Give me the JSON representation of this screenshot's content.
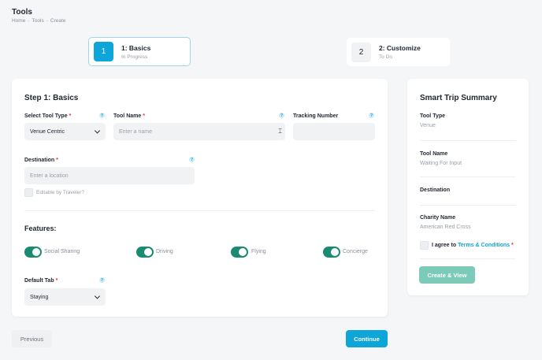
{
  "header": {
    "title": "Tools",
    "breadcrumb": [
      "Home",
      "Tools",
      "Create"
    ],
    "breadcrumb_separator": "-"
  },
  "stepper": [
    {
      "number": "1",
      "title": "1: Basics",
      "status": "In Progress"
    },
    {
      "number": "2",
      "title": "2: Customize",
      "status": "To Do"
    }
  ],
  "form": {
    "heading": "Step 1: Basics",
    "tool_type": {
      "label": "Select Tool Type",
      "required": "*",
      "value": "Venue Centric"
    },
    "tool_name": {
      "label": "Tool Name",
      "required": "*",
      "placeholder": "Enter a name"
    },
    "tracking_number": {
      "label": "Tracking Number",
      "value": ""
    },
    "destination": {
      "label": "Destination",
      "required": "*",
      "placeholder": "Enter a location"
    },
    "editable_by_traveler": {
      "label": "Editable by Traveler?"
    },
    "features_heading": "Features:",
    "features": [
      {
        "label": "Social Sharing",
        "on": true
      },
      {
        "label": "Driving",
        "on": true
      },
      {
        "label": "Flying",
        "on": true
      },
      {
        "label": "Concierge",
        "on": true
      }
    ],
    "default_tab": {
      "label": "Default Tab",
      "required": "*",
      "value": "Staying"
    }
  },
  "summary": {
    "title": "Smart Trip Summary",
    "tool_type_label": "Tool Type",
    "tool_type_value": "Venue",
    "tool_name_label": "Tool Name",
    "tool_name_value": "Waiting For Input",
    "destination_label": "Destination",
    "charity_label": "Charity Name",
    "charity_value": "American Red Cross",
    "agree_prefix": "I agree to",
    "agree_link": "Terms & Conditions",
    "agree_required": "*",
    "create_button": "Create & View"
  },
  "footer": {
    "previous": "Previous",
    "continue": "Continue"
  },
  "icons": {
    "help": "help-icon",
    "chevron": "chevron-down-icon",
    "name_field_icon": "text-cursor-icon"
  },
  "colors": {
    "accent": "#0ea5d8",
    "toggle_on": "#1a8a73",
    "create_button": "#7ccab8",
    "required": "#e0303c"
  }
}
